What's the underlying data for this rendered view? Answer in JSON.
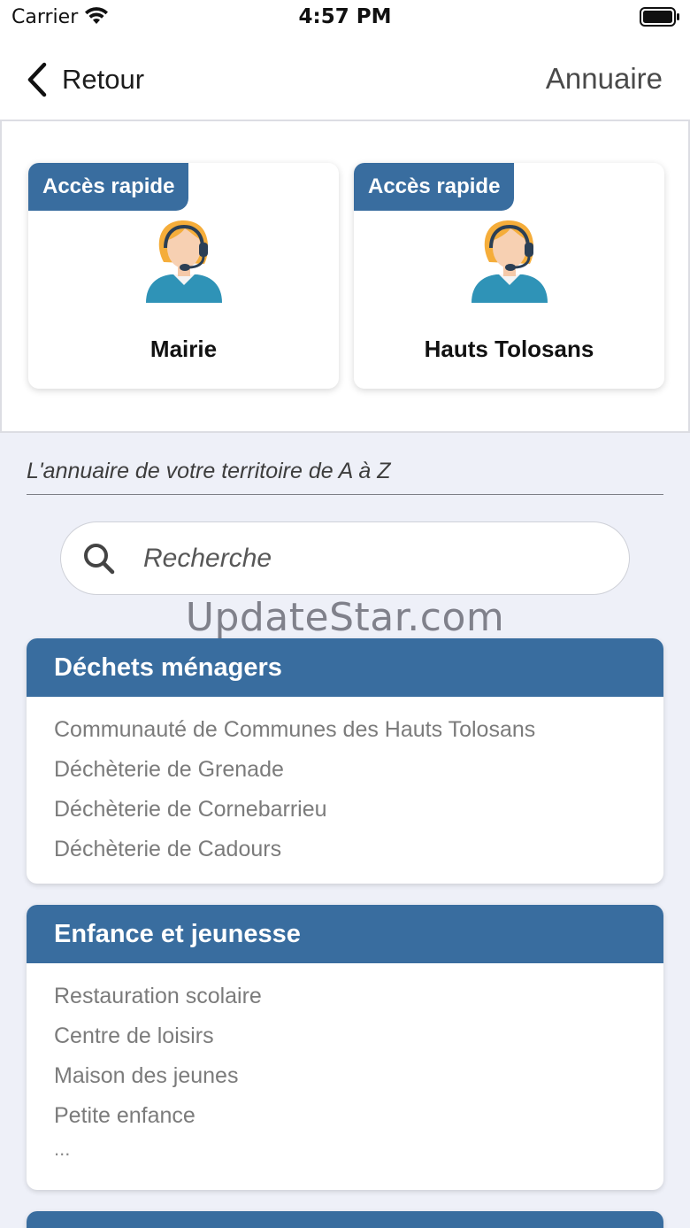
{
  "status_bar": {
    "carrier": "Carrier",
    "time": "4:57 PM",
    "wifi_icon": "wifi-icon",
    "battery_icon": "battery-icon"
  },
  "nav": {
    "back_label": "Retour",
    "back_icon": "chevron-left-icon",
    "title": "Annuaire"
  },
  "quick_access": [
    {
      "badge": "Accès rapide",
      "name": "Mairie",
      "icon": "support-agent-icon"
    },
    {
      "badge": "Accès rapide",
      "name": "Hauts Tolosans",
      "icon": "support-agent-icon"
    }
  ],
  "directory": {
    "intro": "L'annuaire de votre territoire de A à Z",
    "search_placeholder": "Recherche",
    "search_value": "",
    "search_icon": "search-icon"
  },
  "watermark": "UpdateStar.com",
  "categories": [
    {
      "title": "Déchets ménagers",
      "items": [
        "Communauté de Communes des Hauts Tolosans",
        "Déchèterie de Grenade",
        "Déchèterie de Cornebarrieu",
        "Déchèterie de Cadours"
      ]
    },
    {
      "title": "Enfance et jeunesse",
      "items": [
        "Restauration scolaire",
        "Centre de loisirs",
        "Maison des jeunes",
        "Petite enfance"
      ],
      "more": "..."
    }
  ],
  "colors": {
    "accent": "#396d9f",
    "background": "#eef0f8",
    "item_text": "#7b7b7b"
  }
}
